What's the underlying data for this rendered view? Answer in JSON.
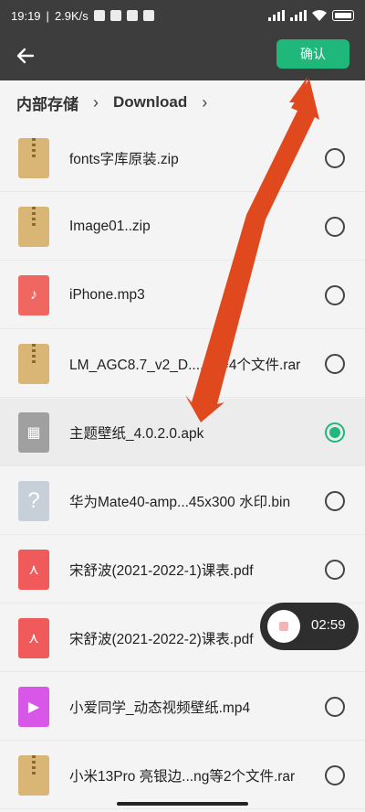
{
  "status_bar": {
    "time": "19:19",
    "network_speed": "2.9K/s",
    "battery": "100"
  },
  "appbar": {
    "confirm_label": "确认"
  },
  "breadcrumb": {
    "root": "内部存储",
    "current": "Download"
  },
  "files": [
    {
      "name": "fonts字库原装.zip",
      "type": "zip",
      "selected": false
    },
    {
      "name": "Image01..zip",
      "type": "zip",
      "selected": false
    },
    {
      "name": "iPhone.mp3",
      "type": "mp3",
      "selected": false
    },
    {
      "name": "LM_AGC8.7_v2_D.....c等4个文件.rar",
      "type": "zip",
      "selected": false
    },
    {
      "name": "主题壁纸_4.0.2.0.apk",
      "type": "apk",
      "selected": true
    },
    {
      "name": "华为Mate40-amp...45x300 水印.bin",
      "type": "bin",
      "selected": false
    },
    {
      "name": "宋舒波(2021-2022-1)课表.pdf",
      "type": "pdf",
      "selected": false
    },
    {
      "name": "宋舒波(2021-2022-2)课表.pdf",
      "type": "pdf",
      "selected": false
    },
    {
      "name": "小爱同学_动态视频壁纸.mp4",
      "type": "mp4",
      "selected": false
    },
    {
      "name": "小米13Pro 亮银边...ng等2个文件.rar",
      "type": "zip",
      "selected": false
    }
  ],
  "recorder": {
    "time": "02:59"
  },
  "colors": {
    "accent": "#20b87a",
    "header": "#3d3d3d",
    "annotation_arrow": "#e0481e"
  }
}
